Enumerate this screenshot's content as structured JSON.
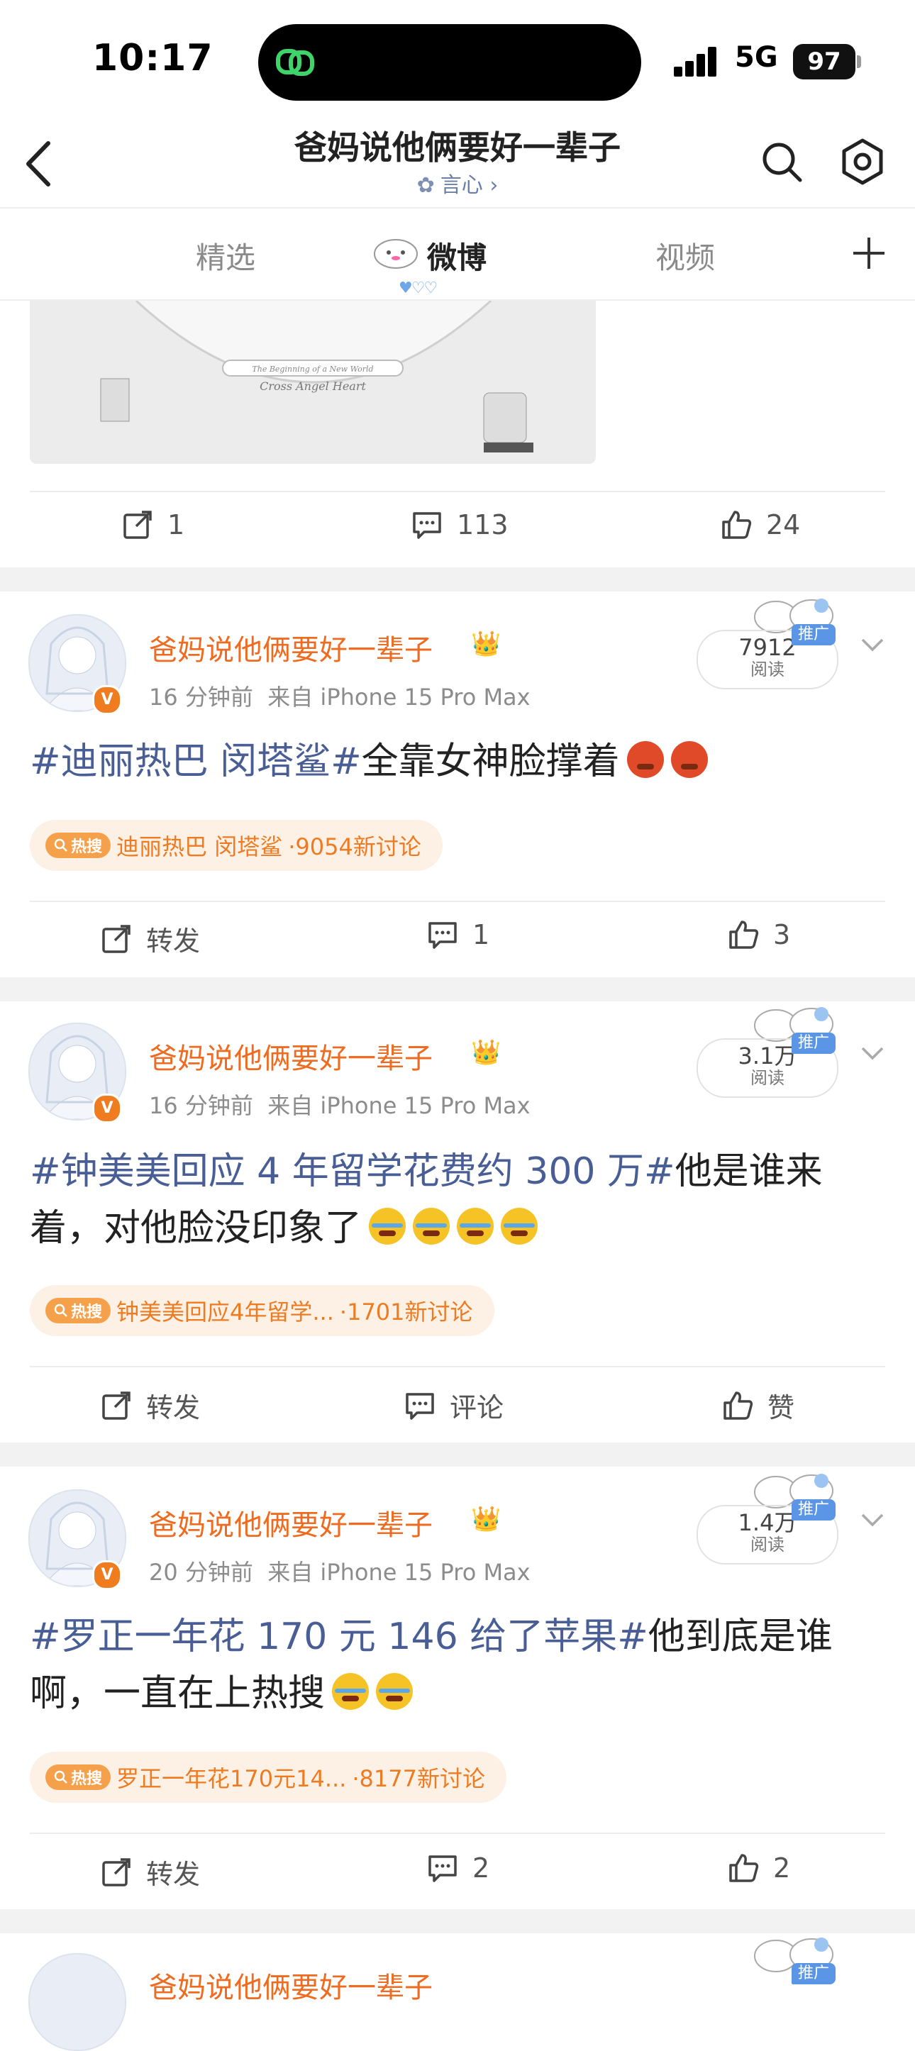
{
  "status": {
    "time": "10:17",
    "network": "5G",
    "battery": "97"
  },
  "header": {
    "title": "爸妈说他俩要好一辈子",
    "subtitle": "言心 ›"
  },
  "tabs": {
    "items": [
      "精选",
      "微博",
      "视频"
    ],
    "active": "微博"
  },
  "first_post_actions": {
    "repost": "1",
    "comment": "113",
    "like": "24"
  },
  "image_texts": {
    "line1": "The Beginning of a New World",
    "line2": "Cross Angel Heart"
  },
  "posts": [
    {
      "username": "爸妈说他俩要好一辈子",
      "time": "16 分钟前",
      "source": "来自 iPhone 15 Pro Max",
      "reads_value": "7912",
      "reads_label": "阅读",
      "promo": "推广",
      "hashtag": "#迪丽热巴 闵塔鲨#",
      "text": "全靠女神脸撑着",
      "emojis": [
        "angry",
        "angry"
      ],
      "hot_label": "热搜",
      "hot_topic": "迪丽热巴 闵塔鲨",
      "hot_count": "·9054新讨论",
      "repost": "转发",
      "comment": "1",
      "like": "3"
    },
    {
      "username": "爸妈说他俩要好一辈子",
      "time": "16 分钟前",
      "source": "来自 iPhone 15 Pro Max",
      "reads_value": "3.1万",
      "reads_label": "阅读",
      "promo": "推广",
      "hashtag": "#钟美美回应 4 年留学花费约 300 万#",
      "text": "他是谁来着，对他脸没印象了",
      "emojis": [
        "laugh",
        "laugh",
        "laugh",
        "laugh"
      ],
      "hot_label": "热搜",
      "hot_topic": "钟美美回应4年留学...",
      "hot_count": "·1701新讨论",
      "repost": "转发",
      "comment": "评论",
      "like": "赞"
    },
    {
      "username": "爸妈说他俩要好一辈子",
      "time": "20 分钟前",
      "source": "来自 iPhone 15 Pro Max",
      "reads_value": "1.4万",
      "reads_label": "阅读",
      "promo": "推广",
      "hashtag": "#罗正一年花 170 元 146 给了苹果#",
      "text": "他到底是谁啊，一直在上热搜",
      "emojis": [
        "cry",
        "cry"
      ],
      "hot_label": "热搜",
      "hot_topic": "罗正一年花170元14...",
      "hot_count": "·8177新讨论",
      "repost": "转发",
      "comment": "2",
      "like": "2"
    }
  ],
  "partial_post": {
    "username": "爸妈说他俩要好一辈子",
    "promo": "推广"
  }
}
